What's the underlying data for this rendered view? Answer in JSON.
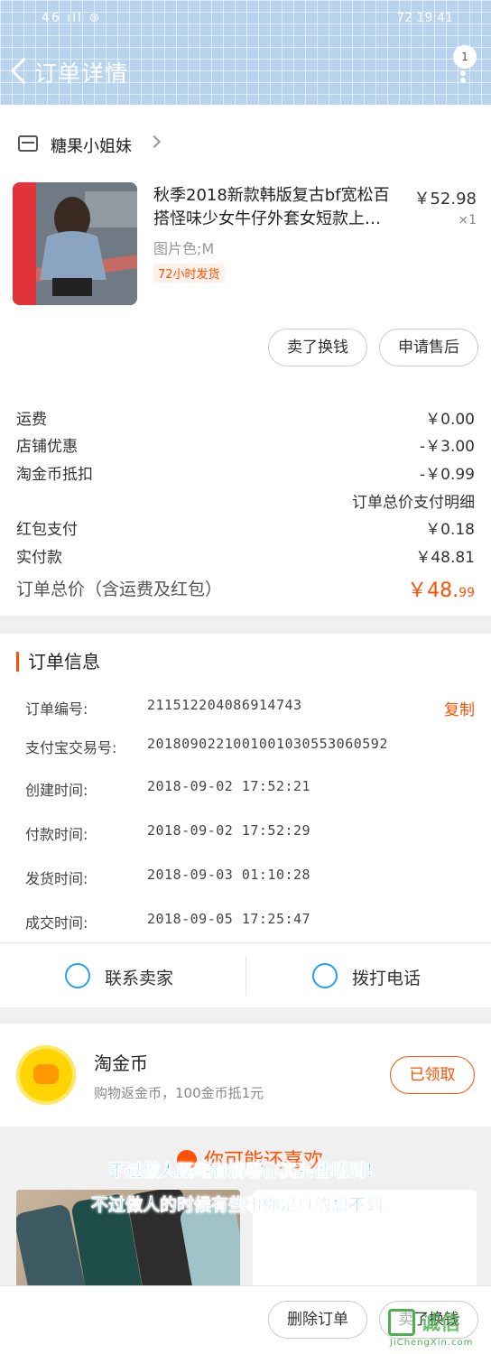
{
  "status_bar": {
    "left": "46 ıll ⊚",
    "right": "72 19:41"
  },
  "header": {
    "title": "订单详情",
    "badge_count": "1"
  },
  "store": {
    "name": "糖果小姐妹"
  },
  "product": {
    "title_line1": "秋季2018新款韩版复古bf宽松百",
    "title_line2": "搭怪味少女牛仔外套女短款上…",
    "price": "￥52.98",
    "quantity": "×1",
    "spec": "图片色;M",
    "shipping_tag": "72小时发货"
  },
  "product_actions": {
    "sell_label": "卖了换钱",
    "aftersale_label": "申请售后"
  },
  "fees": {
    "shipping": {
      "label": "运费",
      "value": "￥0.00"
    },
    "shop_discount": {
      "label": "店铺优惠",
      "value": "-￥3.00"
    },
    "coin_deduct": {
      "label": "淘金币抵扣",
      "value": "-￥0.99"
    },
    "detail_link": "订单总价支付明细",
    "red_packet": {
      "label": "红包支付",
      "value": "￥0.18"
    },
    "paid": {
      "label": "实付款",
      "value": "￥48.81"
    }
  },
  "total": {
    "label": "订单总价（含运费及红包）",
    "value_main": "￥48.",
    "value_cents": "99"
  },
  "order_info": {
    "title": "订单信息",
    "copy_label": "复制",
    "rows": [
      {
        "label": "订单编号:",
        "value": "211512204086914743"
      },
      {
        "label": "支付宝交易号:",
        "value": "2018090221001001030553060592"
      },
      {
        "label": "创建时间:",
        "value": "2018-09-02 17:52:21"
      },
      {
        "label": "付款时间:",
        "value": "2018-09-02 17:52:29"
      },
      {
        "label": "发货时间:",
        "value": "2018-09-03 01:10:28"
      },
      {
        "label": "成交时间:",
        "value": "2018-09-05 17:25:47"
      }
    ]
  },
  "contact": {
    "seller_label": "联系卖家",
    "phone_label": "拨打电话"
  },
  "coin": {
    "title": "淘金币",
    "subtitle": "购物返金币，100金币抵1元",
    "button_label": "已领取"
  },
  "recommend": {
    "heading": "你可能还喜欢"
  },
  "overlay_text": {
    "line1": "不过做人既嘅有滴嘢你真系估唔到！",
    "line2": "不过做人的时候有些事你是真的想不到。"
  },
  "bottom": {
    "delete_label": "删除订单",
    "sell_label": "卖了换钱"
  },
  "watermark": {
    "cn": "诚信",
    "en": "JiChengXin.com"
  },
  "colors": {
    "accent": "#ff5000",
    "link_blue": "#2aa0f0",
    "header_bg": "#b8d3ee"
  }
}
